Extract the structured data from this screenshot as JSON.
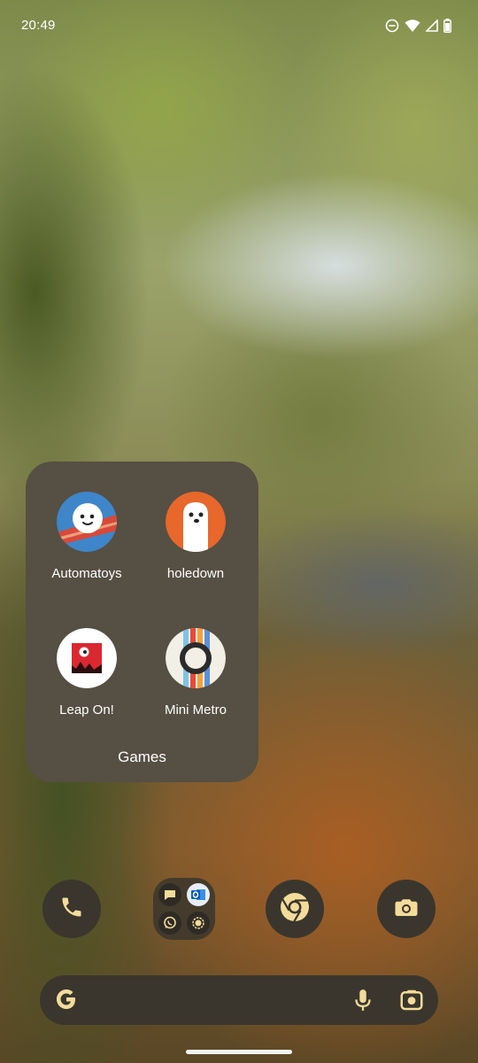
{
  "status_bar": {
    "time": "20:49",
    "icons": [
      "do-not-disturb-icon",
      "wifi-icon",
      "cell-signal-icon",
      "battery-icon"
    ]
  },
  "folder": {
    "name": "Games",
    "apps": [
      {
        "label": "Automatoys",
        "icon": "automatoys-icon"
      },
      {
        "label": "holedown",
        "icon": "holedown-icon"
      },
      {
        "label": "Leap On!",
        "icon": "leap-on-icon"
      },
      {
        "label": "Mini Metro",
        "icon": "mini-metro-icon"
      }
    ]
  },
  "dock": {
    "items": [
      "phone-icon",
      "messaging-folder",
      "chrome-icon",
      "camera-icon"
    ],
    "folder_apps": [
      "messages-icon",
      "outlook-icon",
      "whatsapp-icon",
      "signal-icon"
    ]
  },
  "search": {
    "icons": [
      "google-g-icon",
      "mic-icon",
      "lens-icon"
    ]
  },
  "colors": {
    "folder_bg": "#564f43",
    "dock_bg": "#3a362d",
    "accent": "#f3dc9a"
  }
}
